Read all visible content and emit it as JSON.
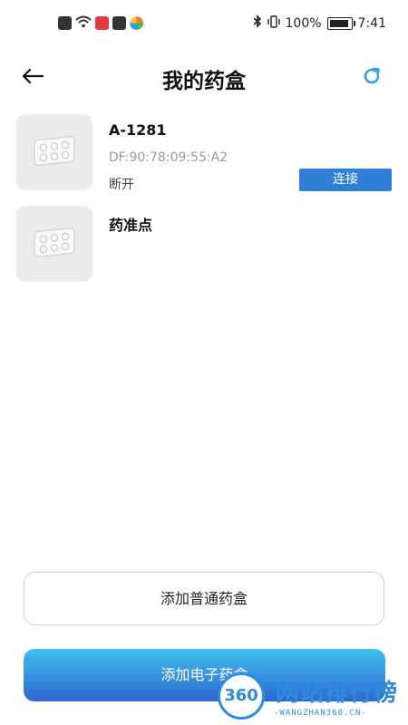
{
  "status_bar": {
    "battery_percent": "100%",
    "time": "7:41",
    "left_icons": [
      "alert-icon",
      "wifi-icon",
      "app-red-icon",
      "mail-icon",
      "app-color-icon"
    ],
    "right_icons": [
      "bluetooth-icon",
      "vibrate-icon",
      "battery-icon"
    ]
  },
  "header": {
    "title": "我的药盒"
  },
  "devices": [
    {
      "name": "A-1281",
      "mac": "DF:90:78:09:55:A2",
      "status": "断开",
      "action_label": "连接"
    },
    {
      "name": "药准点"
    }
  ],
  "actions": {
    "add_normal": "添加普通药盒",
    "add_electronic": "添加电子药盒"
  },
  "watermark": {
    "logo_text": "360",
    "site_name": "网站排行榜",
    "domain": "-WANGZHAN360.CN-"
  },
  "colors": {
    "accent": "#2f7fd6",
    "refresh": "#2ea3e0",
    "gradient_top": "#40c0ee",
    "gradient_bottom": "#2f67d0"
  }
}
